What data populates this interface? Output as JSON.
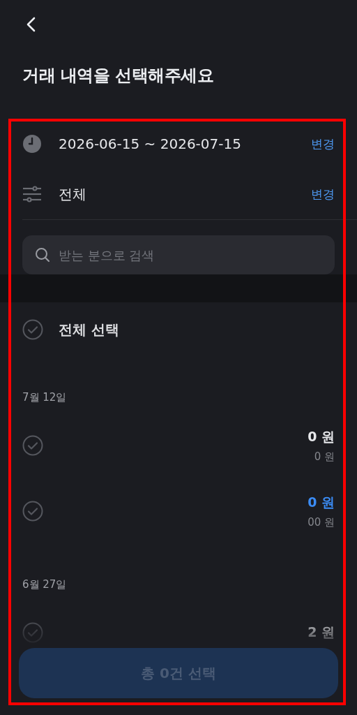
{
  "header": {
    "title": "거래 내역을 선택해주세요"
  },
  "filters": [
    {
      "kind": "period",
      "value": "2026-06-15 ~ 2026-07-15",
      "action": "변경"
    },
    {
      "kind": "category",
      "value": "전체",
      "action": "변경"
    }
  ],
  "search": {
    "placeholder": "받는 분으로 검색"
  },
  "select_all": {
    "label": "전체 선택",
    "checked": false
  },
  "groups": [
    {
      "date": "7월 12일",
      "transactions": [
        {
          "amount": "0 원",
          "balance": "0 원",
          "incoming": false,
          "checked": false
        },
        {
          "amount": "0 원",
          "balance": "00 원",
          "incoming": true,
          "checked": false
        }
      ]
    },
    {
      "date": "6월 27일",
      "transactions": [
        {
          "amount": "2 원",
          "incoming": false,
          "checked": false
        }
      ]
    }
  ],
  "confirm_button": {
    "label": "총 0건 선택",
    "disabled": true
  }
}
